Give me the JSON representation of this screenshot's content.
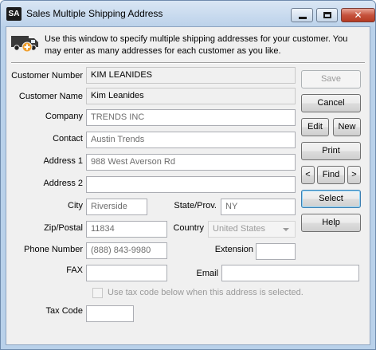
{
  "window": {
    "icon_text": "SA",
    "title": "Sales Multiple Shipping Address",
    "close_glyph": "✕"
  },
  "info": {
    "text": "Use this window to specify multiple shipping addresses for your customer. You may enter as many addresses for each customer as you like."
  },
  "form": {
    "customer_number": {
      "label": "Customer Number",
      "value": "KIM LEANIDES"
    },
    "customer_name": {
      "label": "Customer Name",
      "value": "Kim Leanides"
    },
    "company": {
      "label": "Company",
      "value": "TRENDS INC"
    },
    "contact": {
      "label": "Contact",
      "value": "Austin Trends"
    },
    "address1": {
      "label": "Address 1",
      "value": "988 West Averson Rd"
    },
    "address2": {
      "label": "Address 2",
      "value": ""
    },
    "city": {
      "label": "City",
      "value": "Riverside"
    },
    "state": {
      "label": "State/Prov.",
      "value": "NY"
    },
    "zip": {
      "label": "Zip/Postal",
      "value": "11834"
    },
    "country": {
      "label": "Country",
      "value": "United States"
    },
    "phone": {
      "label": "Phone Number",
      "value": "(888) 843-9980"
    },
    "extension": {
      "label": "Extension",
      "value": ""
    },
    "fax": {
      "label": "FAX",
      "value": ""
    },
    "email": {
      "label": "Email",
      "value": ""
    },
    "use_tax_code": {
      "label": "Use tax code below when this address is selected.",
      "checked": false
    },
    "tax_code": {
      "label": "Tax Code",
      "value": ""
    }
  },
  "buttons": {
    "save": "Save",
    "cancel": "Cancel",
    "edit": "Edit",
    "new": "New",
    "print": "Print",
    "prev": "<",
    "find": "Find",
    "next": ">",
    "select": "Select",
    "help": "Help"
  }
}
